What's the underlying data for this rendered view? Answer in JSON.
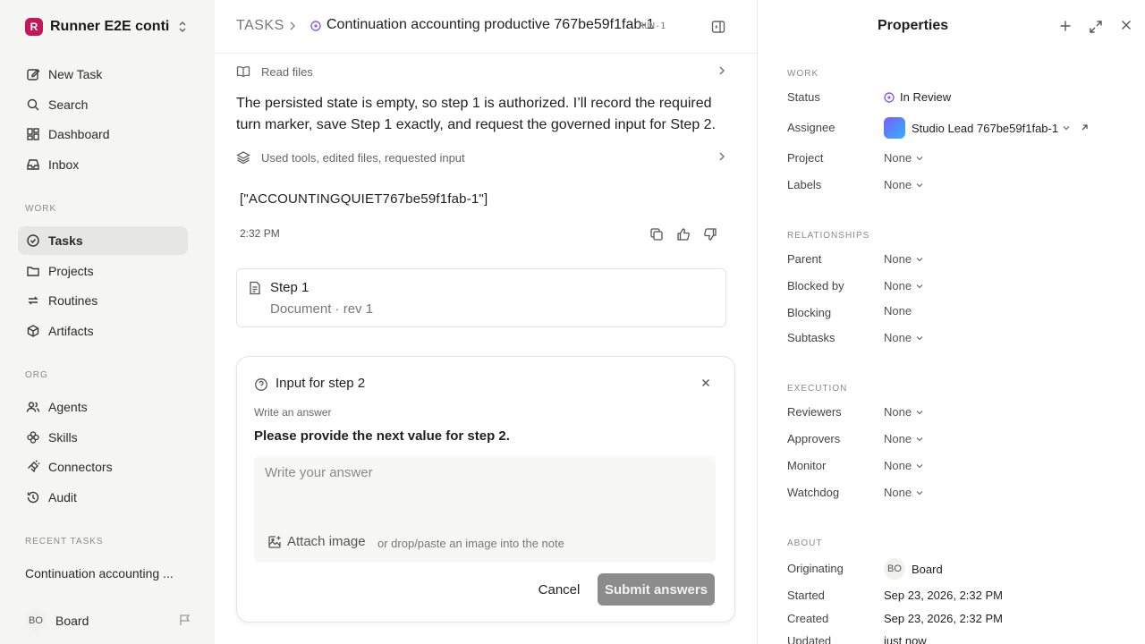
{
  "sidebar": {
    "workspace": {
      "logo": "R",
      "name": "Runner E2E conti..."
    },
    "nav_top": [
      {
        "label": "New Task",
        "icon": "edit-icon"
      },
      {
        "label": "Search",
        "icon": "search-icon"
      },
      {
        "label": "Dashboard",
        "icon": "dashboard-icon"
      },
      {
        "label": "Inbox",
        "icon": "inbox-icon"
      }
    ],
    "work_label": "WORK",
    "nav_work": [
      {
        "label": "Tasks",
        "icon": "check-circle-icon",
        "active": true
      },
      {
        "label": "Projects",
        "icon": "folder-icon"
      },
      {
        "label": "Routines",
        "icon": "repeat-icon"
      },
      {
        "label": "Artifacts",
        "icon": "box-icon"
      }
    ],
    "org_label": "ORG",
    "nav_org": [
      {
        "label": "Agents",
        "icon": "users-icon"
      },
      {
        "label": "Skills",
        "icon": "flower-icon"
      },
      {
        "label": "Connectors",
        "icon": "plug-icon"
      },
      {
        "label": "Audit",
        "icon": "history-icon"
      }
    ],
    "recent_label": "RECENT TASKS",
    "recent_items": [
      "Continuation accounting ..."
    ],
    "user": {
      "initials": "BO",
      "name": "Board"
    }
  },
  "header": {
    "root": "TASKS",
    "title": "Continuation accounting productive 767be59f1fab-1",
    "run_tag": "RUN-1"
  },
  "thread": {
    "read_files": "Read files",
    "message": "The persisted state is empty, so step 1 is authorized. I’ll record the required turn marker, save Step 1 exactly, and request the governed input for Step 2.",
    "tools_summary": "Used tools, edited files, requested input",
    "output": "[\"ACCOUNTINGQUIET767be59f1fab-1\"]",
    "time": "2:32 PM",
    "document": {
      "title": "Step 1",
      "subtitle": "Document · rev 1"
    }
  },
  "input_card": {
    "title": "Input for step 2",
    "label": "Write an answer",
    "question": "Please provide the next value for step 2.",
    "placeholder": "Write your answer",
    "attach_label": "Attach image",
    "attach_hint": "or drop/paste an image into the note",
    "cancel": "Cancel",
    "submit": "Submit answers"
  },
  "properties": {
    "title": "Properties",
    "work_label": "WORK",
    "status_label": "Status",
    "status_value": "In Review",
    "assignee_label": "Assignee",
    "assignee_value": "Studio Lead 767be59f1fab-1",
    "project_label": "Project",
    "project_value": "None",
    "labels_label": "Labels",
    "labels_value": "None",
    "relationships_label": "RELATIONSHIPS",
    "parent_label": "Parent",
    "parent_value": "None",
    "blocked_by_label": "Blocked by",
    "blocked_by_value": "None",
    "blocking_label": "Blocking",
    "blocking_value": "None",
    "subtasks_label": "Subtasks",
    "subtasks_value": "None",
    "execution_label": "EXECUTION",
    "reviewers_label": "Reviewers",
    "reviewers_value": "None",
    "approvers_label": "Approvers",
    "approvers_value": "None",
    "monitor_label": "Monitor",
    "monitor_value": "None",
    "watchdog_label": "Watchdog",
    "watchdog_value": "None",
    "about_label": "ABOUT",
    "originating_label": "Originating",
    "originating_initials": "BO",
    "originating_value": "Board",
    "started_label": "Started",
    "started_value": "Sep 23, 2026, 2:32 PM",
    "created_label": "Created",
    "created_value": "Sep 23, 2026, 2:32 PM",
    "updated_label": "Updated",
    "updated_value": "just now"
  },
  "colors": {
    "accent_status": "#8b5cf6",
    "sidebar_bg": "#f5f5f4",
    "submit_bg": "#8c8c8c",
    "logo_bg": "#c2185b"
  }
}
